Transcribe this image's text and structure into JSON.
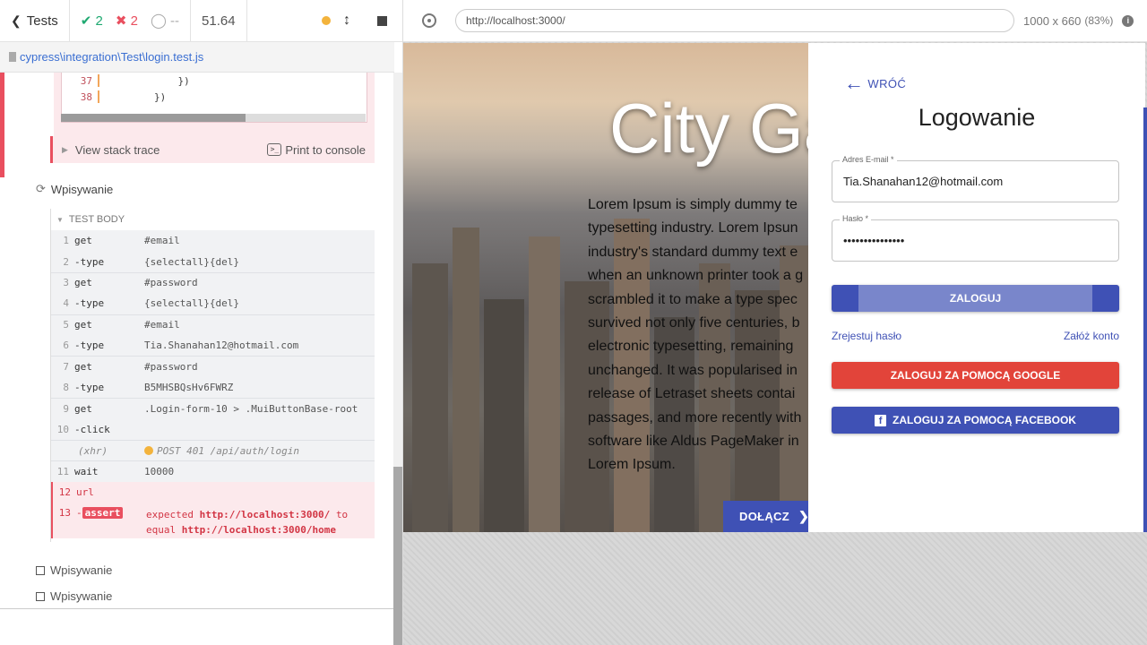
{
  "reporter": {
    "header": {
      "tests_label": "Tests",
      "passed": "2",
      "failed": "2",
      "pending": "--",
      "duration": "51.64"
    },
    "spec_path": "cypress\\integration\\Test\\login.test.js",
    "code_frame": [
      {
        "line": "37",
        "src": "            })"
      },
      {
        "line": "38",
        "src": "        })"
      }
    ],
    "view_stack_trace": "View stack trace",
    "print_to_console": "Print to console",
    "test_title": "Wpisywanie",
    "test_body_label": "TEST BODY",
    "commands": [
      {
        "num": "1",
        "name": "get",
        "msg": "#email"
      },
      {
        "num": "2",
        "name": "-type",
        "msg": "{selectall}{del}"
      },
      {
        "num": "3",
        "name": "get",
        "msg": "#password"
      },
      {
        "num": "4",
        "name": "-type",
        "msg": "{selectall}{del}"
      },
      {
        "num": "5",
        "name": "get",
        "msg": "#email"
      },
      {
        "num": "6",
        "name": "-type",
        "msg": "Tia.Shanahan12@hotmail.com"
      },
      {
        "num": "7",
        "name": "get",
        "msg": "#password"
      },
      {
        "num": "8",
        "name": "-type",
        "msg": "B5MHSBQsHv6FWRZ"
      },
      {
        "num": "9",
        "name": "get",
        "msg": ".Login-form-10 > .MuiButtonBase-root"
      },
      {
        "num": "10",
        "name": "-click",
        "msg": ""
      },
      {
        "num": "",
        "name": "(xhr)",
        "msg": "POST 401 /api/auth/login"
      },
      {
        "num": "11",
        "name": "wait",
        "msg": "10000"
      },
      {
        "num": "12",
        "name": "url",
        "msg": ""
      },
      {
        "num": "13",
        "name": "assert",
        "msg_expected": "expected",
        "msg_url1": "http://localhost:3000/",
        "msg_to": "to",
        "msg_equal": "equal",
        "msg_url2": "http://localhost:3000/home"
      }
    ],
    "pending_tests": [
      "Wpisywanie",
      "Wpisywanie"
    ]
  },
  "aut": {
    "url": "http://localhost:3000/",
    "viewport": "1000 x 660",
    "zoom": "(83%)",
    "hero_title": "City Ga",
    "lorem_lines": [
      "Lorem Ipsum is simply dummy te",
      "typesetting industry. Lorem Ipsun",
      "industry's standard dummy text e",
      "when an unknown printer took a g",
      "scrambled it to make a type spec",
      "survived not only five centuries, b",
      "electronic typesetting, remaining",
      "unchanged. It was popularised in",
      "release of Letraset sheets contai",
      "passages, and more recently with",
      "software like Aldus PageMaker in",
      "Lorem Ipsum."
    ],
    "join_button": "DOŁĄCZ",
    "login": {
      "back": "WRÓĆ",
      "title": "Logowanie",
      "email_label": "Adres E-mail *",
      "email_value": "Tia.Shanahan12@hotmail.com",
      "password_label": "Hasło *",
      "password_value": "•••••••••••••••",
      "login_button": "ZALOGUJ",
      "register_link": "Zrejestuj hasło",
      "create_account_link": "Załóż konto",
      "google_button": "ZALOGUJ ZA POMOCĄ GOOGLE",
      "facebook_button": "ZALOGUJ ZA POMOCĄ FACEBOOK"
    }
  },
  "colors": {
    "pass": "#1fa971",
    "fail": "#e94f5f",
    "primary": "#3f51b5",
    "google": "#e2443a"
  }
}
